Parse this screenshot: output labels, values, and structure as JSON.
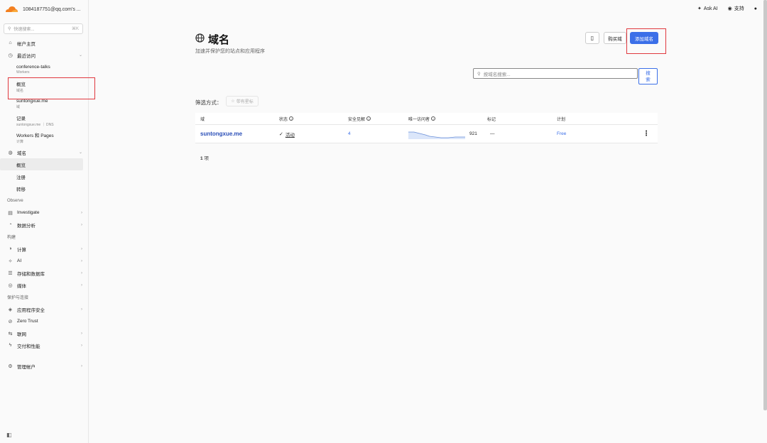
{
  "account": {
    "name": "1084187751@qq.com's ..."
  },
  "sidebar": {
    "search": {
      "placeholder": "快速搜索...",
      "shortcut": "⌘K"
    },
    "home": "帐户主页",
    "recent": {
      "label": "最近访问",
      "items": [
        {
          "title": "conference-talks",
          "sub": "Workers"
        },
        {
          "title": "概览",
          "sub": "域名"
        },
        {
          "title": "suntongxue.me",
          "sub": "域"
        },
        {
          "title": "记录",
          "sub": "suntongxue.me ｜ DNS"
        },
        {
          "title": "Workers 和 Pages",
          "sub": "计算"
        }
      ]
    },
    "domains": {
      "label": "域名",
      "children": [
        "概览",
        "注册",
        "转移"
      ]
    },
    "observe": {
      "heading": "Observe",
      "items": [
        "Investigate",
        "数据分析"
      ]
    },
    "build": {
      "heading": "构建",
      "items": [
        "计算",
        "AI",
        "存储和数据库",
        "媒体"
      ]
    },
    "protect": {
      "heading": "保护与连接",
      "items": [
        "应用程序安全",
        "Zero Trust",
        "联网",
        "交付和性能"
      ]
    },
    "manage": "管理帐户"
  },
  "topbar": {
    "ask_ai": "Ask AI",
    "support": "支持"
  },
  "page": {
    "title": "域名",
    "subtitle": "加速并保护您的站点和应用程序",
    "buy_domain": "购买域",
    "add_domain": "添加域名",
    "search_placeholder": "按域名搜索...",
    "search_button": "搜索",
    "filter_label": "筛选方式：",
    "filter_chip": "带有星标"
  },
  "table": {
    "headers": [
      "域",
      "状态",
      "安全见解",
      "唯一访问者",
      "标记",
      "计划"
    ],
    "rows": [
      {
        "domain": "suntongxue.me",
        "status": "活动",
        "insights": "4",
        "visitors": "921",
        "tags": "—",
        "plan": "Free"
      }
    ],
    "count_num": "1",
    "count_label": "项"
  },
  "colors": {
    "accent": "#3b6fe8",
    "highlight": "#e0383e",
    "cloudflare": "#f38020"
  }
}
